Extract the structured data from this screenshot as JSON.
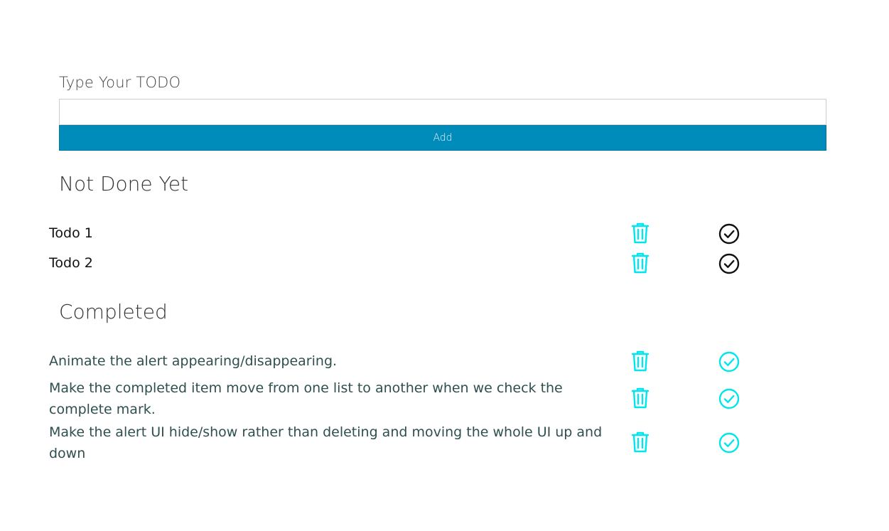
{
  "form": {
    "label": "Type Your TODO",
    "input_value": "",
    "input_placeholder": "",
    "add_label": "Add"
  },
  "colors": {
    "accent": "#008cba",
    "icon_active": "#00e5ee",
    "icon_dark": "#111111"
  },
  "sections": {
    "pending": {
      "heading": "Not Done Yet",
      "items": [
        {
          "text": "Todo 1",
          "delete_icon": "trash-icon",
          "complete_icon": "check-circle-icon"
        },
        {
          "text": "Todo 2",
          "delete_icon": "trash-icon",
          "complete_icon": "check-circle-icon"
        }
      ]
    },
    "completed": {
      "heading": "Completed",
      "items": [
        {
          "text": "Animate the alert appearing/disappearing.",
          "delete_icon": "trash-icon",
          "complete_icon": "check-circle-icon"
        },
        {
          "text": "Make the completed item move from one list to another when we check the complete mark.",
          "delete_icon": "trash-icon",
          "complete_icon": "check-circle-icon"
        },
        {
          "text": "Make the alert UI hide/show rather than deleting and moving the whole UI up and down",
          "delete_icon": "trash-icon",
          "complete_icon": "check-circle-icon"
        }
      ]
    }
  }
}
